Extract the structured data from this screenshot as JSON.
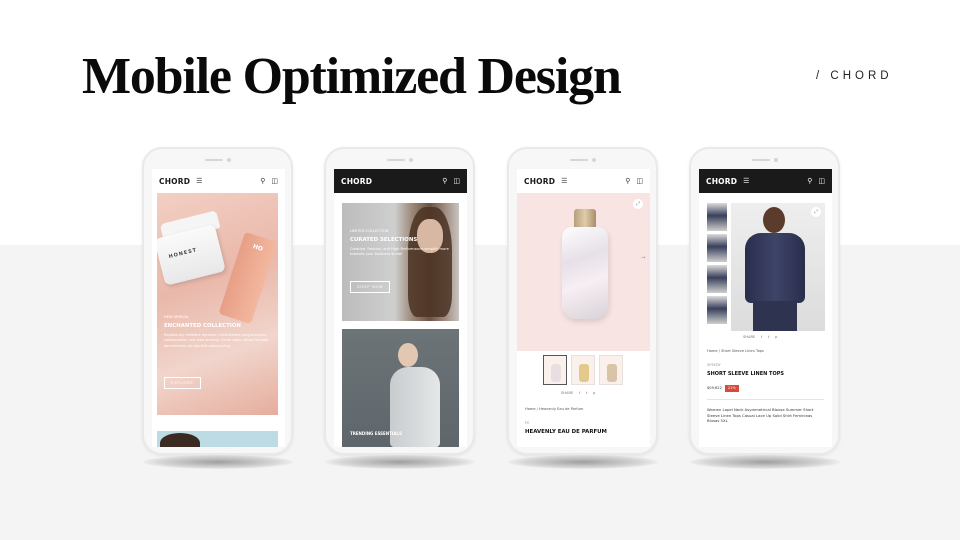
{
  "slide": {
    "title": "Mobile Optimized Design",
    "brand_tag": "/  CHORD"
  },
  "phones": [
    {
      "logo": "CHORD",
      "nav_style": "light",
      "hero_tag": "NEW ARRIVAL",
      "hero_title": "ENCHANTED COLLECTION",
      "hero_text": "Rapidiously redefine dynamic niche before plug-and-play collaboration and idea sharing. Continually utilize focused benchmarks via top-line outsourcing.",
      "hero_button": "EXPLORE",
      "product_label_1": "HONEST",
      "product_label_2": "HO"
    },
    {
      "logo": "CHORD",
      "nav_style": "dark",
      "card1_tag": "LIMITED COLLECTION",
      "card1_title": "CURATED SELECTIONS",
      "card1_text": "Creative, Fashion, and High Performance simplify more towards your business shine!",
      "card1_button": "SHOP NOW",
      "card2_title": "TRENDING ESSENTIALS"
    },
    {
      "logo": "CHORD",
      "nav_style": "light",
      "share_label": "SHARE",
      "breadcrumb": "Home  /  Heavenly Eau de Parfum",
      "product_tag": "FE",
      "product_title": "HEAVENLY EAU DE PARFUM"
    },
    {
      "logo": "CHORD",
      "nav_style": "dark",
      "share_label": "SHARE",
      "breadcrumb": "Home  /  Short Sleeve Linen Tops",
      "product_tag": "SPEEDY",
      "product_title": "SHORT SLEEVE LINEN TOPS",
      "price": "$09.622",
      "discount": "21%",
      "description": "Women Lapel Neck Asymmetrical Blouse Summer Short Sleeve Linen Tops Casual Lace Up Solid Shirt Femininas Blusas 5XL"
    }
  ],
  "icons": {
    "menu": "hamburger-icon",
    "search": "search-icon",
    "bag": "shopping-bag-icon",
    "arrow": "arrow-right-icon",
    "expand": "expand-icon",
    "social": [
      "facebook-icon",
      "twitter-icon",
      "pinterest-icon"
    ]
  },
  "colors": {
    "background": "#ffffff",
    "band": "#f4f4f4",
    "dark_nav": "#1a1a1a",
    "discount": "#d84a3a"
  }
}
